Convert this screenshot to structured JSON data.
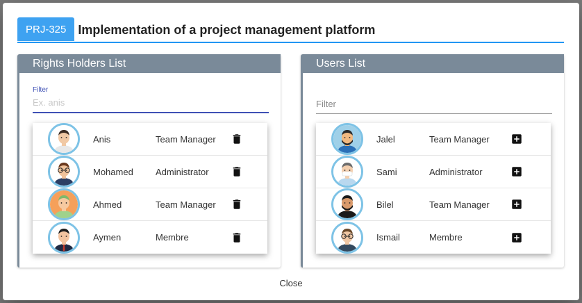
{
  "dialog": {
    "code": "PRJ-325",
    "title": "Implementation of a project management platform",
    "close_label": "Close"
  },
  "rights_holders": {
    "header": "Rights Holders List",
    "filter_label": "Filter",
    "filter_placeholder": "Ex. anis",
    "filter_value": "",
    "items": [
      {
        "name": "Anis",
        "role": "Team Manager",
        "avatar": "avatar-man-light",
        "action": "trash-icon"
      },
      {
        "name": "Mohamed",
        "role": "Administrator",
        "avatar": "avatar-man-glasses",
        "action": "trash-icon"
      },
      {
        "name": "Ahmed",
        "role": "Team Manager",
        "avatar": "avatar-man-orange",
        "action": "trash-icon"
      },
      {
        "name": "Aymen",
        "role": "Membre",
        "avatar": "avatar-man-suit",
        "action": "trash-icon"
      }
    ]
  },
  "users": {
    "header": "Users List",
    "filter_placeholder": "Filter",
    "filter_value": "",
    "items": [
      {
        "name": "Jalel",
        "role": "Team Manager",
        "avatar": "avatar-man-beard",
        "action": "plus-square-icon"
      },
      {
        "name": "Sami",
        "role": "Administrator",
        "avatar": "avatar-man-mask",
        "action": "plus-square-icon"
      },
      {
        "name": "Bilel",
        "role": "Team Manager",
        "avatar": "avatar-man-dark",
        "action": "plus-square-icon"
      },
      {
        "name": "Ismail",
        "role": "Membre",
        "avatar": "avatar-man-tie",
        "action": "plus-square-icon"
      }
    ]
  },
  "colors": {
    "accent": "#2196f3",
    "badge": "#3ea2f1",
    "panel_header": "#7a8a99",
    "avatar_ring": "#7ec3e6"
  }
}
